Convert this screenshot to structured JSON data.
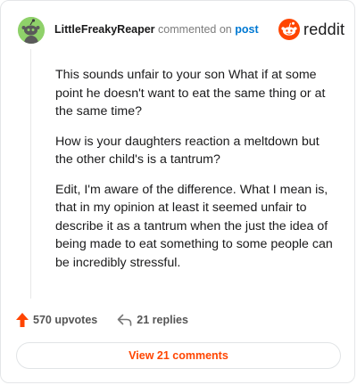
{
  "header": {
    "username": "LittleFreakyReaper",
    "action_text": "commented on",
    "post_link": "post",
    "brand": "reddit"
  },
  "comment": {
    "paragraphs": [
      "This sounds unfair to your son What if at some point he doesn't want to eat the same thing or at the same time?",
      "How is your daughters reaction a meltdown but the other child's is a tantrum?",
      "Edit, I'm aware of the difference. What I mean is, that in my opinion at least it seemed unfair to describe it as a tantrum when the just the idea of being made to eat something to some people can be incredibly stressful."
    ]
  },
  "stats": {
    "upvotes": "570 upvotes",
    "replies": "21 replies"
  },
  "footer": {
    "view_button": "View 21 comments"
  },
  "colors": {
    "accent": "#ff4500",
    "link": "#0079d3",
    "avatar_bg": "#8fd16a"
  },
  "icons": {
    "avatar": "snoo-avatar-icon",
    "brand": "reddit-logo-icon",
    "upvote": "upvote-arrow-icon",
    "reply": "reply-arrow-icon"
  }
}
